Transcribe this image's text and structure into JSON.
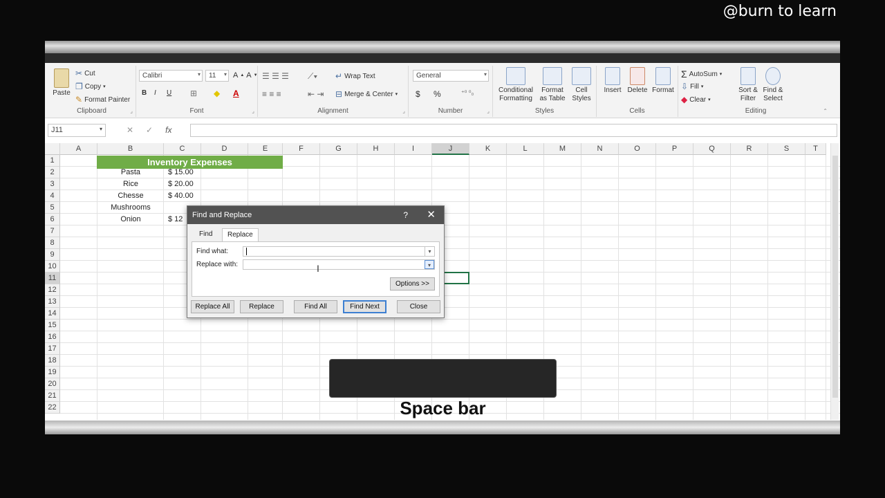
{
  "watermark": "@burn to learn",
  "ribbon": {
    "clipboard": {
      "paste": "Paste",
      "cut": "Cut",
      "copy": "Copy",
      "format_painter": "Format Painter",
      "label": "Clipboard"
    },
    "font": {
      "name": "Calibri",
      "size": "11",
      "label": "Font",
      "bold": "B",
      "italic": "I",
      "underline": "U"
    },
    "alignment": {
      "wrap": "Wrap Text",
      "merge": "Merge & Center",
      "label": "Alignment"
    },
    "number": {
      "format": "General",
      "label": "Number",
      "currency": "$",
      "percent": "%"
    },
    "styles": {
      "conditional": "Conditional Formatting",
      "table": "Format as Table",
      "cell": "Cell Styles",
      "label": "Styles"
    },
    "cells": {
      "insert": "Insert",
      "delete": "Delete",
      "format": "Format",
      "label": "Cells"
    },
    "editing": {
      "autosum": "AutoSum",
      "fill": "Fill",
      "clear": "Clear",
      "sort": "Sort & Filter",
      "find": "Find & Select",
      "label": "Editing"
    }
  },
  "formula_bar": {
    "name_box": "J11",
    "fx": "fx"
  },
  "columns": [
    "A",
    "B",
    "C",
    "D",
    "E",
    "F",
    "G",
    "H",
    "I",
    "J",
    "K",
    "L",
    "M",
    "N",
    "O",
    "P",
    "Q",
    "R",
    "S",
    "T"
  ],
  "rows": [
    "1",
    "2",
    "3",
    "4",
    "5",
    "6",
    "7",
    "8",
    "9",
    "10",
    "11",
    "12",
    "13",
    "14",
    "15",
    "16",
    "17",
    "18",
    "19",
    "20",
    "21",
    "22"
  ],
  "sheet": {
    "title": "Inventory Expenses",
    "items": [
      {
        "name": "Pasta",
        "amount": "$  15.00"
      },
      {
        "name": "Rice",
        "amount": "$  20.00"
      },
      {
        "name": "Chesse",
        "amount": "$  40.00"
      },
      {
        "name": "Mushrooms",
        "amount": ""
      },
      {
        "name": "Onion",
        "amount": "$  12"
      }
    ]
  },
  "dialog": {
    "title": "Find and Replace",
    "help": "?",
    "close": "✕",
    "tab_find": "Find",
    "tab_replace": "Replace",
    "find_label": "Find what:",
    "replace_label": "Replace with:",
    "options": "Options >>",
    "buttons": {
      "replace_all": "Replace All",
      "replace": "Replace",
      "find_all": "Find All",
      "find_next": "Find Next",
      "close": "Close"
    }
  },
  "key_overlay": "Space bar"
}
